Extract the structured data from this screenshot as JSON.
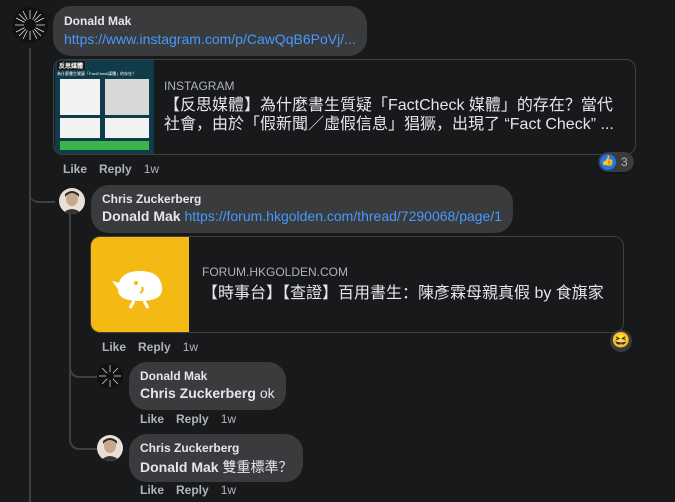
{
  "comment1": {
    "author": "Donald Mak",
    "link": "https://www.instagram.com/p/CawQqB6PoVj/...",
    "card": {
      "source": "INSTAGRAM",
      "text": "【反思媒體】為什麼書生質疑「FactCheck 媒體」的存在？當代社會，由於「假新聞／虛假信息」猖獗，出現了 “Fact Check” ...",
      "thumb_header": "反思媒體",
      "thumb_sub": "為什麼書生質疑「FactCheck媒體」的存在？"
    },
    "actions": {
      "like": "Like",
      "reply": "Reply",
      "time": "1w"
    },
    "reaction_count": "3"
  },
  "reply1": {
    "author": "Chris Zuckerberg",
    "mention": "Donald Mak",
    "link": "https://forum.hkgolden.com/thread/7290068/page/1",
    "card": {
      "source": "FORUM.HKGOLDEN.COM",
      "title": "【時事台】【查證】百用書生：陳彥霖母親真假 by 食旗家"
    },
    "actions": {
      "like": "Like",
      "reply": "Reply",
      "time": "1w"
    }
  },
  "reply2": {
    "author": "Donald Mak",
    "mention": "Chris Zuckerberg",
    "text": "ok",
    "actions": {
      "like": "Like",
      "reply": "Reply",
      "time": "1w"
    }
  },
  "reply3": {
    "author": "Chris Zuckerberg",
    "mention": "Donald Mak",
    "text": "雙重標準？",
    "actions": {
      "like": "Like",
      "reply": "Reply",
      "time": "1w"
    }
  },
  "colors": {
    "background": "#18191a",
    "bubble": "#3a3b3c",
    "link": "#4599ff",
    "card_yellow": "#f5b914",
    "like_blue": "#1877f2"
  }
}
